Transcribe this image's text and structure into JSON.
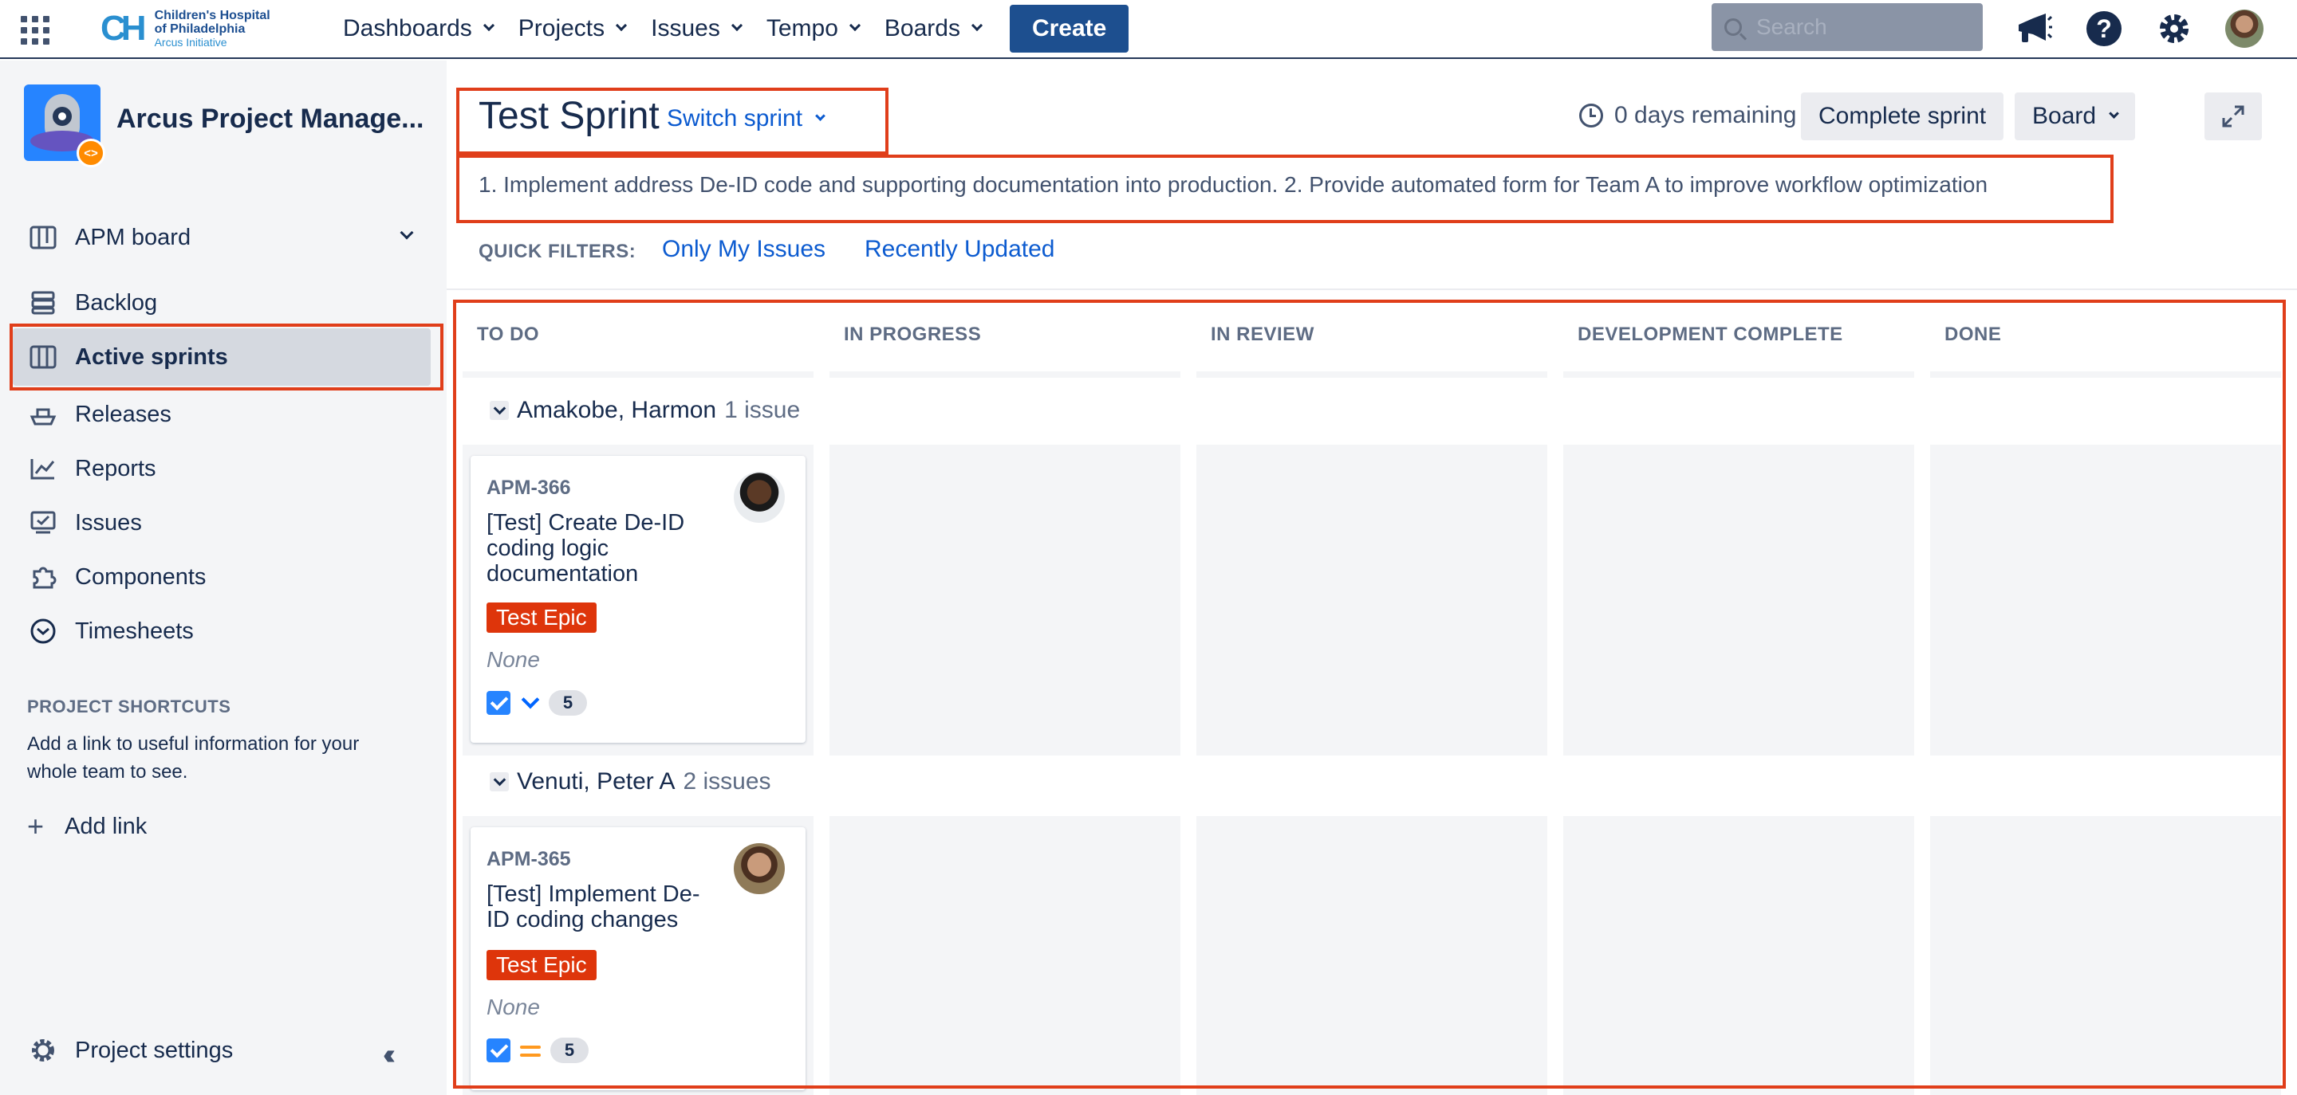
{
  "topnav": {
    "logo": {
      "mark": "CH",
      "line1": "Children's Hospital",
      "line2": "of Philadelphia",
      "line3": "Arcus Initiative"
    },
    "items": [
      {
        "label": "Dashboards"
      },
      {
        "label": "Projects"
      },
      {
        "label": "Issues"
      },
      {
        "label": "Tempo"
      },
      {
        "label": "Boards"
      }
    ],
    "create_label": "Create",
    "search_placeholder": "Search",
    "icons": [
      "megaphone-icon",
      "help-icon",
      "settings-icon",
      "user-avatar"
    ]
  },
  "sidebar": {
    "project_name": "Arcus Project Manage...",
    "project_badge": "<>",
    "board_selector": "APM board",
    "items": [
      {
        "label": "Backlog",
        "icon": "backlog-icon"
      },
      {
        "label": "Active sprints",
        "icon": "board-icon",
        "active": true
      },
      {
        "label": "Releases",
        "icon": "ship-icon"
      },
      {
        "label": "Reports",
        "icon": "chart-icon"
      },
      {
        "label": "Issues",
        "icon": "issues-icon"
      },
      {
        "label": "Components",
        "icon": "puzzle-icon"
      },
      {
        "label": "Timesheets",
        "icon": "clock-icon"
      }
    ],
    "shortcuts_heading": "PROJECT SHORTCUTS",
    "shortcuts_text": "Add a link to useful information for your whole team to see.",
    "add_link": "Add link",
    "project_settings": "Project settings"
  },
  "main": {
    "sprint_title": "Test Sprint",
    "switch_sprint": "Switch sprint",
    "days_remaining": "0 days remaining",
    "complete_sprint": "Complete sprint",
    "board_button": "Board",
    "sprint_goal": "1. Implement address De-ID code and supporting documentation into production. 2. Provide automated form for Team A to improve workflow optimization",
    "quick_filters_label": "QUICK FILTERS:",
    "quick_filters": [
      "Only My Issues",
      "Recently Updated"
    ],
    "columns": [
      "TO DO",
      "IN PROGRESS",
      "IN REVIEW",
      "DEVELOPMENT COMPLETE",
      "DONE"
    ],
    "swimlanes": [
      {
        "assignee": "Amakobe, Harmon",
        "count": "1 issue",
        "cards": [
          {
            "key": "APM-366",
            "summary": "[Test] Create De-ID coding logic documentation",
            "epic": "Test Epic",
            "fix": "None",
            "priority": "low",
            "points": "5"
          }
        ]
      },
      {
        "assignee": "Venuti, Peter A",
        "count": "2 issues",
        "cards": [
          {
            "key": "APM-365",
            "summary": "[Test] Implement De-ID coding changes",
            "epic": "Test Epic",
            "fix": "None",
            "priority": "medium",
            "points": "5"
          }
        ]
      }
    ]
  },
  "colors": {
    "accent": "#0c5bd0",
    "create_button": "#1d4f8f",
    "epic": "#de350b",
    "annotation": "#e03e1a"
  }
}
